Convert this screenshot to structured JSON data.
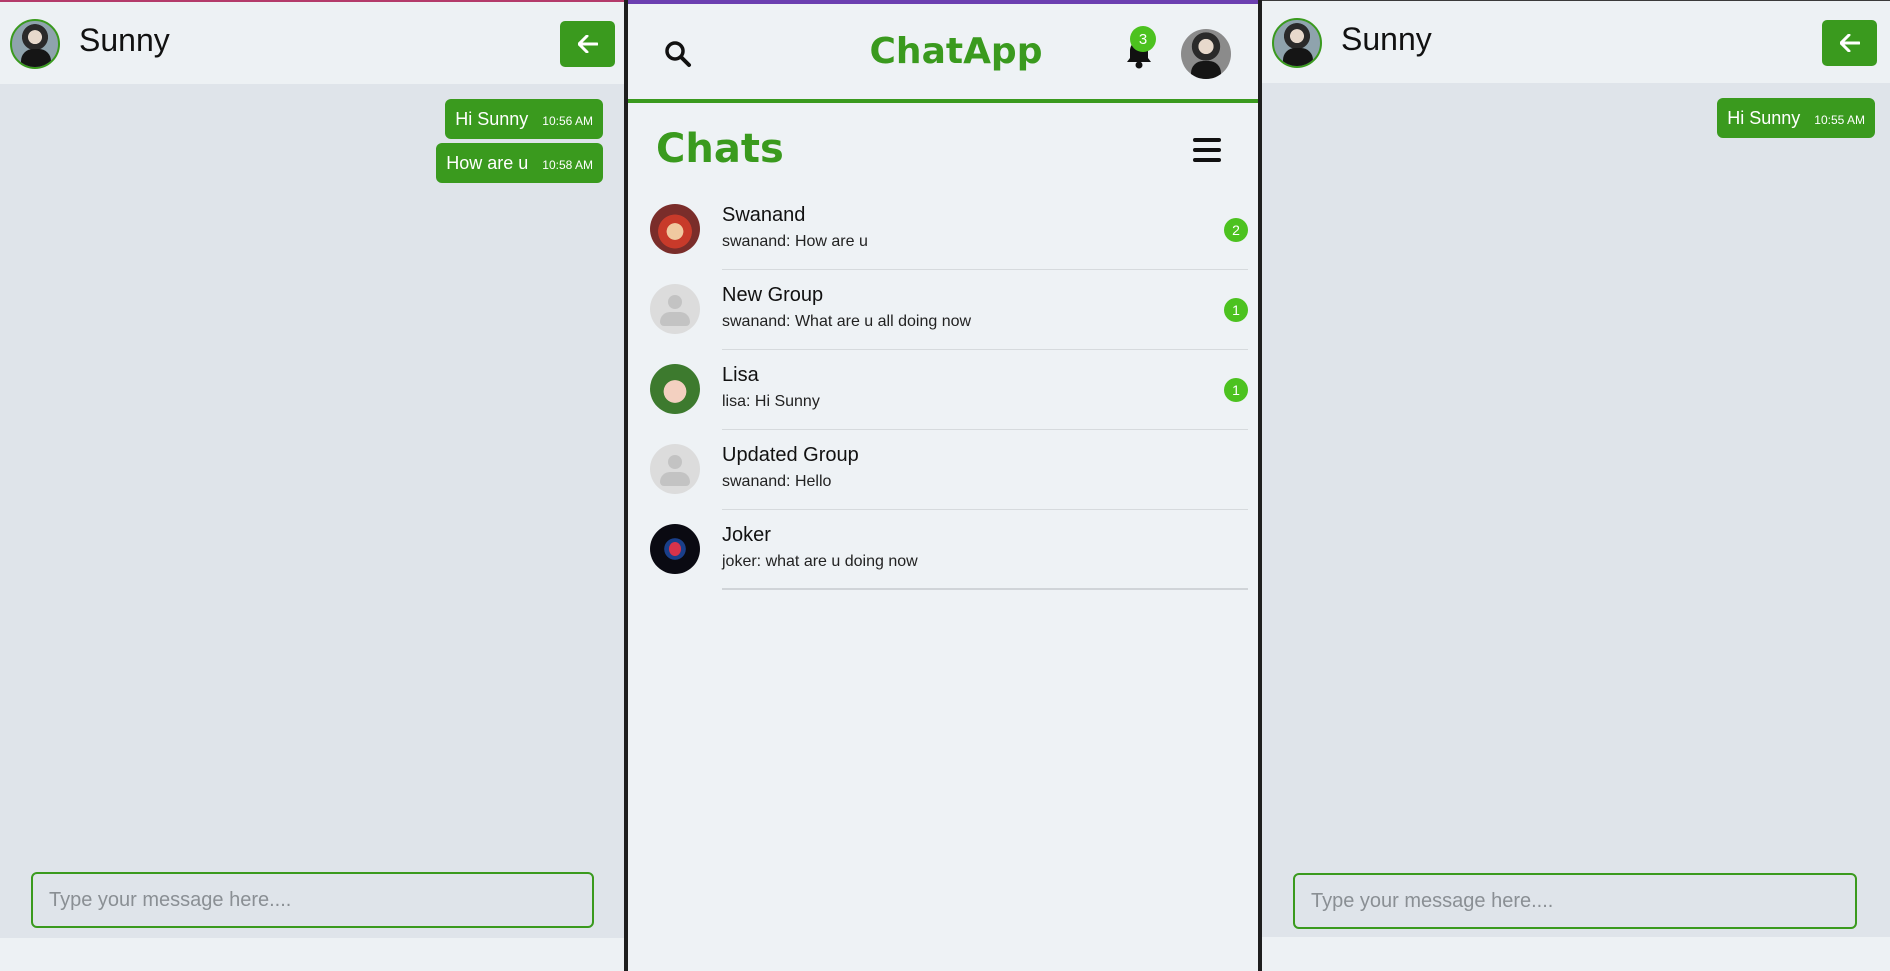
{
  "left_chat": {
    "contact_name": "Sunny",
    "messages": [
      {
        "text": "Hi Sunny",
        "time": "10:56 AM"
      },
      {
        "text": "How are u",
        "time": "10:58 AM"
      }
    ],
    "input_placeholder": "Type your message here...."
  },
  "main": {
    "app_title": "ChatApp",
    "notification_count": "3",
    "chats_heading": "Chats",
    "chats": [
      {
        "name": "Swanand",
        "preview": "swanand: How are u",
        "unread": "2",
        "avatar": "swanand-avatar"
      },
      {
        "name": "New Group",
        "preview": "swanand: What are u all doing now",
        "unread": "1",
        "avatar": "default-avatar"
      },
      {
        "name": "Lisa",
        "preview": "lisa: Hi Sunny",
        "unread": "1",
        "avatar": "lisa-avatar"
      },
      {
        "name": "Updated Group",
        "preview": "swanand: Hello",
        "unread": "",
        "avatar": "default-avatar"
      },
      {
        "name": "Joker",
        "preview": "joker: what are u doing now",
        "unread": "",
        "avatar": "joker-avatar"
      }
    ]
  },
  "right_chat": {
    "contact_name": "Sunny",
    "messages": [
      {
        "text": "Hi Sunny",
        "time": "10:55 AM"
      }
    ],
    "input_placeholder": "Type your message here...."
  },
  "colors": {
    "accent": "#3a9a1e",
    "badge": "#4cc21f",
    "chat_background": "#dfe4ea",
    "panel_background": "#eef2f5"
  },
  "icons": [
    "search-icon",
    "bell-icon",
    "menu-icon",
    "back-arrow-icon",
    "avatar"
  ]
}
